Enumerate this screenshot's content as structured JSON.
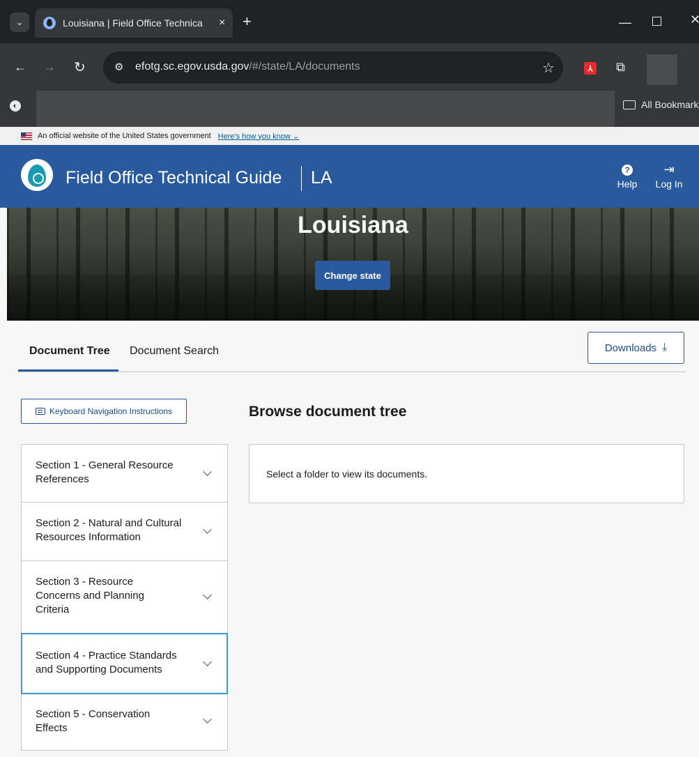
{
  "browser": {
    "tab_title": "Louisiana | Field Office Technica",
    "tab_close": "×",
    "new_tab": "+",
    "window_minimize": "—",
    "window_close": "✕",
    "url_host": "efotg.sc.egov.usda.gov",
    "url_path": "/#/state/LA/documents",
    "bookmarks_label": "All Bookmarks"
  },
  "gov_banner": {
    "text": "An official website of the United States government",
    "link": "Here's how you know ⌄"
  },
  "header": {
    "title": "Field Office Technical Guide",
    "state": "LA",
    "help_label": "Help",
    "login_label": "Log In"
  },
  "hero": {
    "title": "Louisiana",
    "change_state": "Change state"
  },
  "tabs": {
    "document_tree": "Document Tree",
    "document_search": "Document Search",
    "downloads": "Downloads"
  },
  "keyboard_nav": "Keyboard Navigation Instructions",
  "tree": {
    "items": [
      {
        "label": "Section 1 - General Resource References"
      },
      {
        "label": "Section 2 - Natural and Cultural Resources Information"
      },
      {
        "label": "Section 3 - Resource Concerns and Planning Criteria"
      },
      {
        "label": "Section 4 - Practice Standards and Supporting Documents"
      },
      {
        "label": "Section 5 - Conservation Effects"
      }
    ]
  },
  "browse": {
    "title": "Browse document tree",
    "empty_message": "Select a folder to view its documents."
  },
  "icons": {
    "tab_menu": "chevron-down-icon",
    "favicon": "water-drop-icon",
    "back": "arrow-left-icon",
    "forward": "arrow-right-icon",
    "reload": "reload-icon",
    "site_info": "tune-icon",
    "bookmark": "star-icon",
    "pdf_extension": "pdf-icon",
    "extensions": "puzzle-icon",
    "help": "help-circle-icon",
    "login": "login-icon",
    "download": "download-icon",
    "keyboard": "keyboard-icon"
  },
  "colors": {
    "brand_blue": "#2a5a9e",
    "active_outline": "#3a9bd3"
  }
}
